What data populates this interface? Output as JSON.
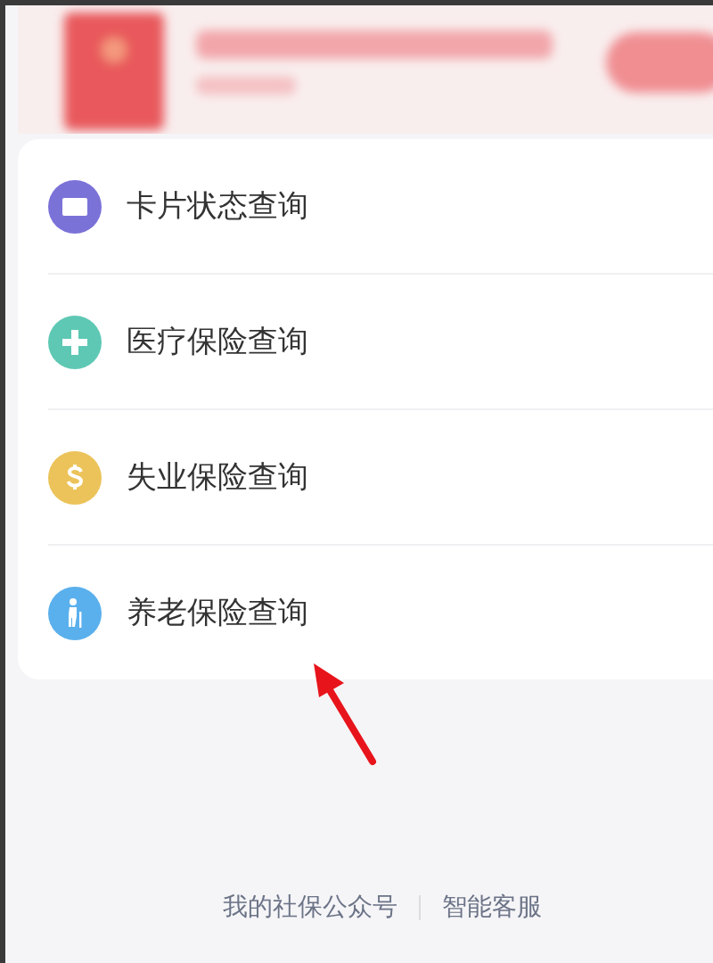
{
  "menu": [
    {
      "label": "卡片状态查询",
      "kind": "card",
      "color": "#7b72d8"
    },
    {
      "label": "医疗保险查询",
      "kind": "medical",
      "color": "#5ec8b4"
    },
    {
      "label": "失业保险查询",
      "kind": "money",
      "color": "#ecc35a"
    },
    {
      "label": "养老保险查询",
      "kind": "elder",
      "color": "#5ab0ec"
    }
  ],
  "footer_links": [
    "我的社保公众号",
    "智能客服"
  ]
}
